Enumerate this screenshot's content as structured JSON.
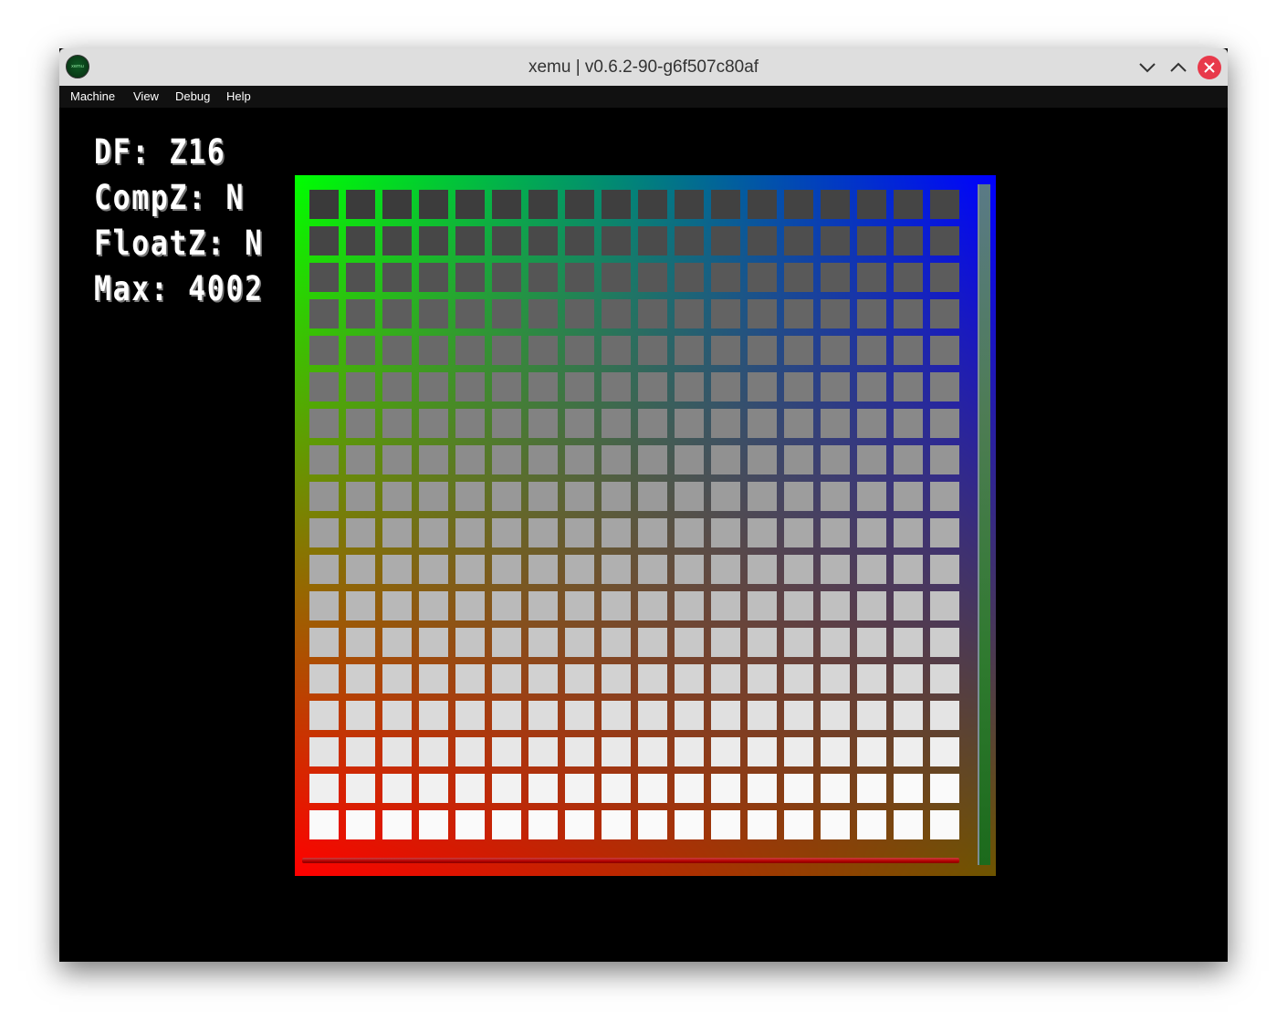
{
  "window": {
    "title": "xemu | v0.6.2-90-g6f507c80af",
    "app_icon_label": "xemu"
  },
  "menu": {
    "items": [
      "Machine",
      "View",
      "Debug",
      "Help"
    ]
  },
  "overlay": {
    "lines": [
      "DF: Z16",
      "CompZ: N",
      "FloatZ: N",
      "Max: 4002"
    ]
  },
  "test_pattern": {
    "grid_rows": 18,
    "grid_cols": 18,
    "corner_colors": {
      "top_left": "#00ff00",
      "top_right": "#0000ff",
      "bottom_left": "#ff0000",
      "bottom_right": "#6e5500"
    },
    "cell_gray_top": "#3a3a3a",
    "cell_gray_bottom": "#fafafa",
    "close_button_color": "#e8394a"
  }
}
